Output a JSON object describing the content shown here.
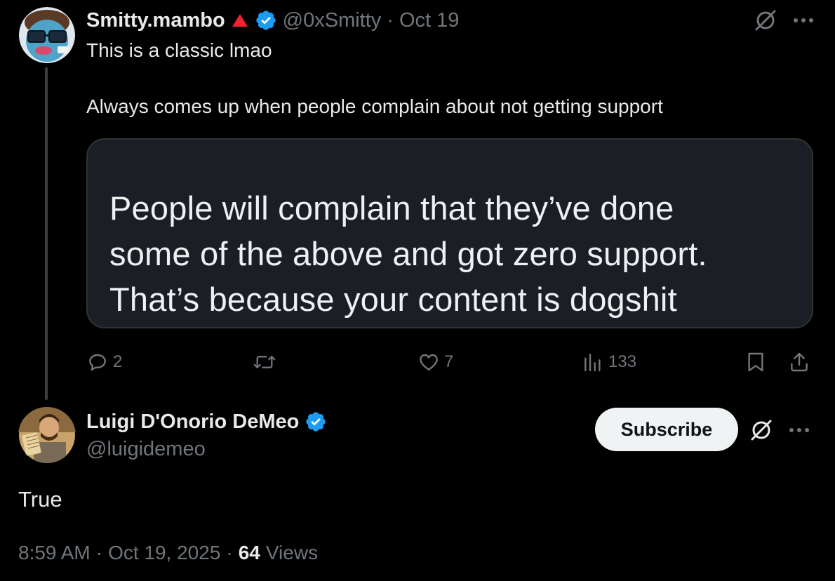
{
  "parent_tweet": {
    "author_name": "Smitty.mambo",
    "handle": "@0xSmitty",
    "separator": "·",
    "date": "Oct 19",
    "text_line1": "This is a classic lmao",
    "text_line2": "Always comes up when people complain about not getting support",
    "media_text": {
      "line1": "People will complain that they’ve done",
      "line2": "some of the above and got zero support.",
      "line3": "That’s because your content is dogshit"
    },
    "actions": {
      "replies": "2",
      "retweets": "",
      "likes": "7",
      "views": "133"
    },
    "icons": {
      "badge": "red-triangle-icon",
      "verified": "verified-badge-icon",
      "grok": "grok-icon",
      "more": "more-icon"
    }
  },
  "reply": {
    "author_name": "Luigi D'Onorio DeMeo",
    "handle": "@luigidemeo",
    "subscribe_label": "Subscribe",
    "text": "True",
    "time": "8:59 AM",
    "separator": "·",
    "date": "Oct 19, 2025",
    "views_count": "64",
    "views_label": "Views"
  },
  "colors": {
    "background": "#000000",
    "text_primary": "#e7e9ea",
    "text_secondary": "#71767b",
    "verified_blue": "#1d9bf0",
    "badge_red": "#f4212e",
    "card_background": "#1b1f25"
  }
}
